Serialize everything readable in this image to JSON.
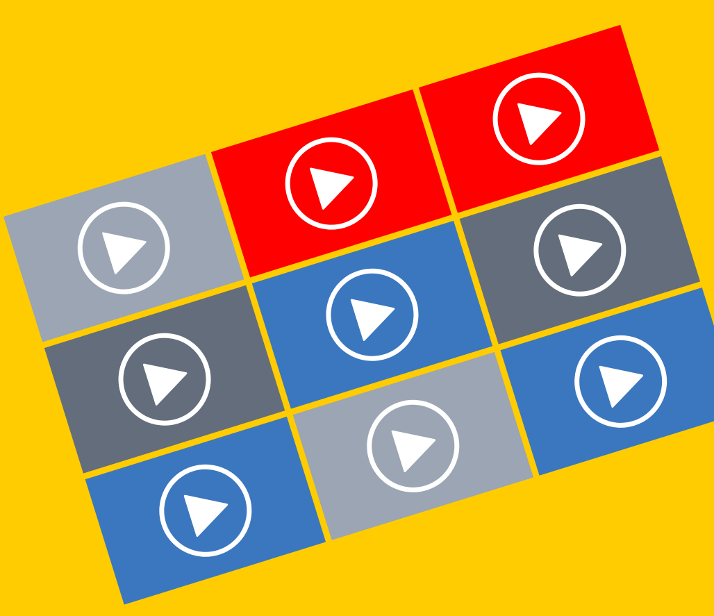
{
  "background_color": "#FECC00",
  "play_icon_color": "#FFFFFF",
  "tile_colors": {
    "red": "#FF0000",
    "blue": "#3A77BE",
    "dark_gray": "#636D7C",
    "light_gray": "#9BA5B3"
  },
  "tiles": [
    {
      "row": 0,
      "col": 0,
      "color": "light_gray",
      "icon": "play-circle-icon"
    },
    {
      "row": 0,
      "col": 1,
      "color": "red",
      "icon": "play-circle-icon"
    },
    {
      "row": 0,
      "col": 2,
      "color": "red",
      "icon": "play-circle-icon"
    },
    {
      "row": 1,
      "col": 0,
      "color": "dark_gray",
      "icon": "play-circle-icon"
    },
    {
      "row": 1,
      "col": 1,
      "color": "blue",
      "icon": "play-circle-icon"
    },
    {
      "row": 1,
      "col": 2,
      "color": "dark_gray",
      "icon": "play-circle-icon"
    },
    {
      "row": 2,
      "col": 0,
      "color": "blue",
      "icon": "play-circle-icon"
    },
    {
      "row": 2,
      "col": 1,
      "color": "light_gray",
      "icon": "play-circle-icon"
    },
    {
      "row": 2,
      "col": 2,
      "color": "blue",
      "icon": "play-circle-icon"
    }
  ]
}
